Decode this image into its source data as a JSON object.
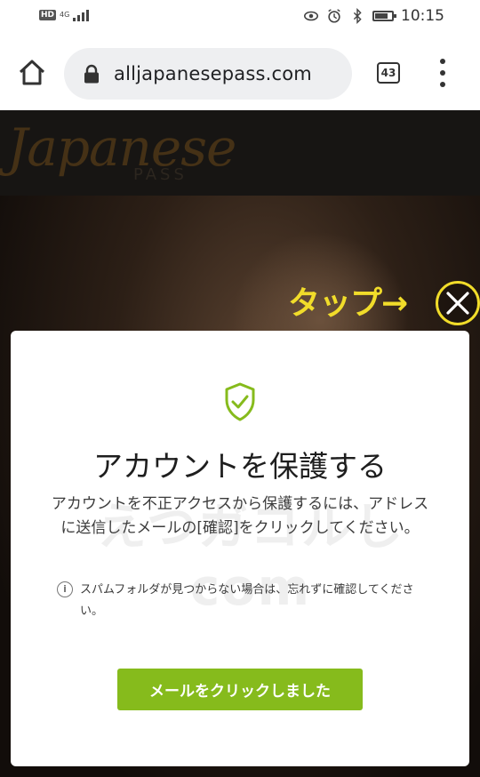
{
  "status_bar": {
    "network_badge": "HD",
    "network_type": "4G",
    "time": "10:15",
    "battery_level": 0.8
  },
  "browser": {
    "url": "alljapanesepass.com",
    "tab_count": "43"
  },
  "site": {
    "logo_text": "Japanese",
    "logo_sub": "PASS"
  },
  "annotation": {
    "tap_label": "タップ→"
  },
  "modal": {
    "title": "アカウントを保護する",
    "body": "アカウントを不正アクセスから保護するには、アドレスに送信したメールの[確認]をクリックしてください。",
    "info": "スパムフォルダが見つからない場合は、忘れずに確認してください。",
    "button_label": "メールをクリックしました",
    "watermark": "えつガコルしcom",
    "accent_color": "#86bb1c"
  }
}
